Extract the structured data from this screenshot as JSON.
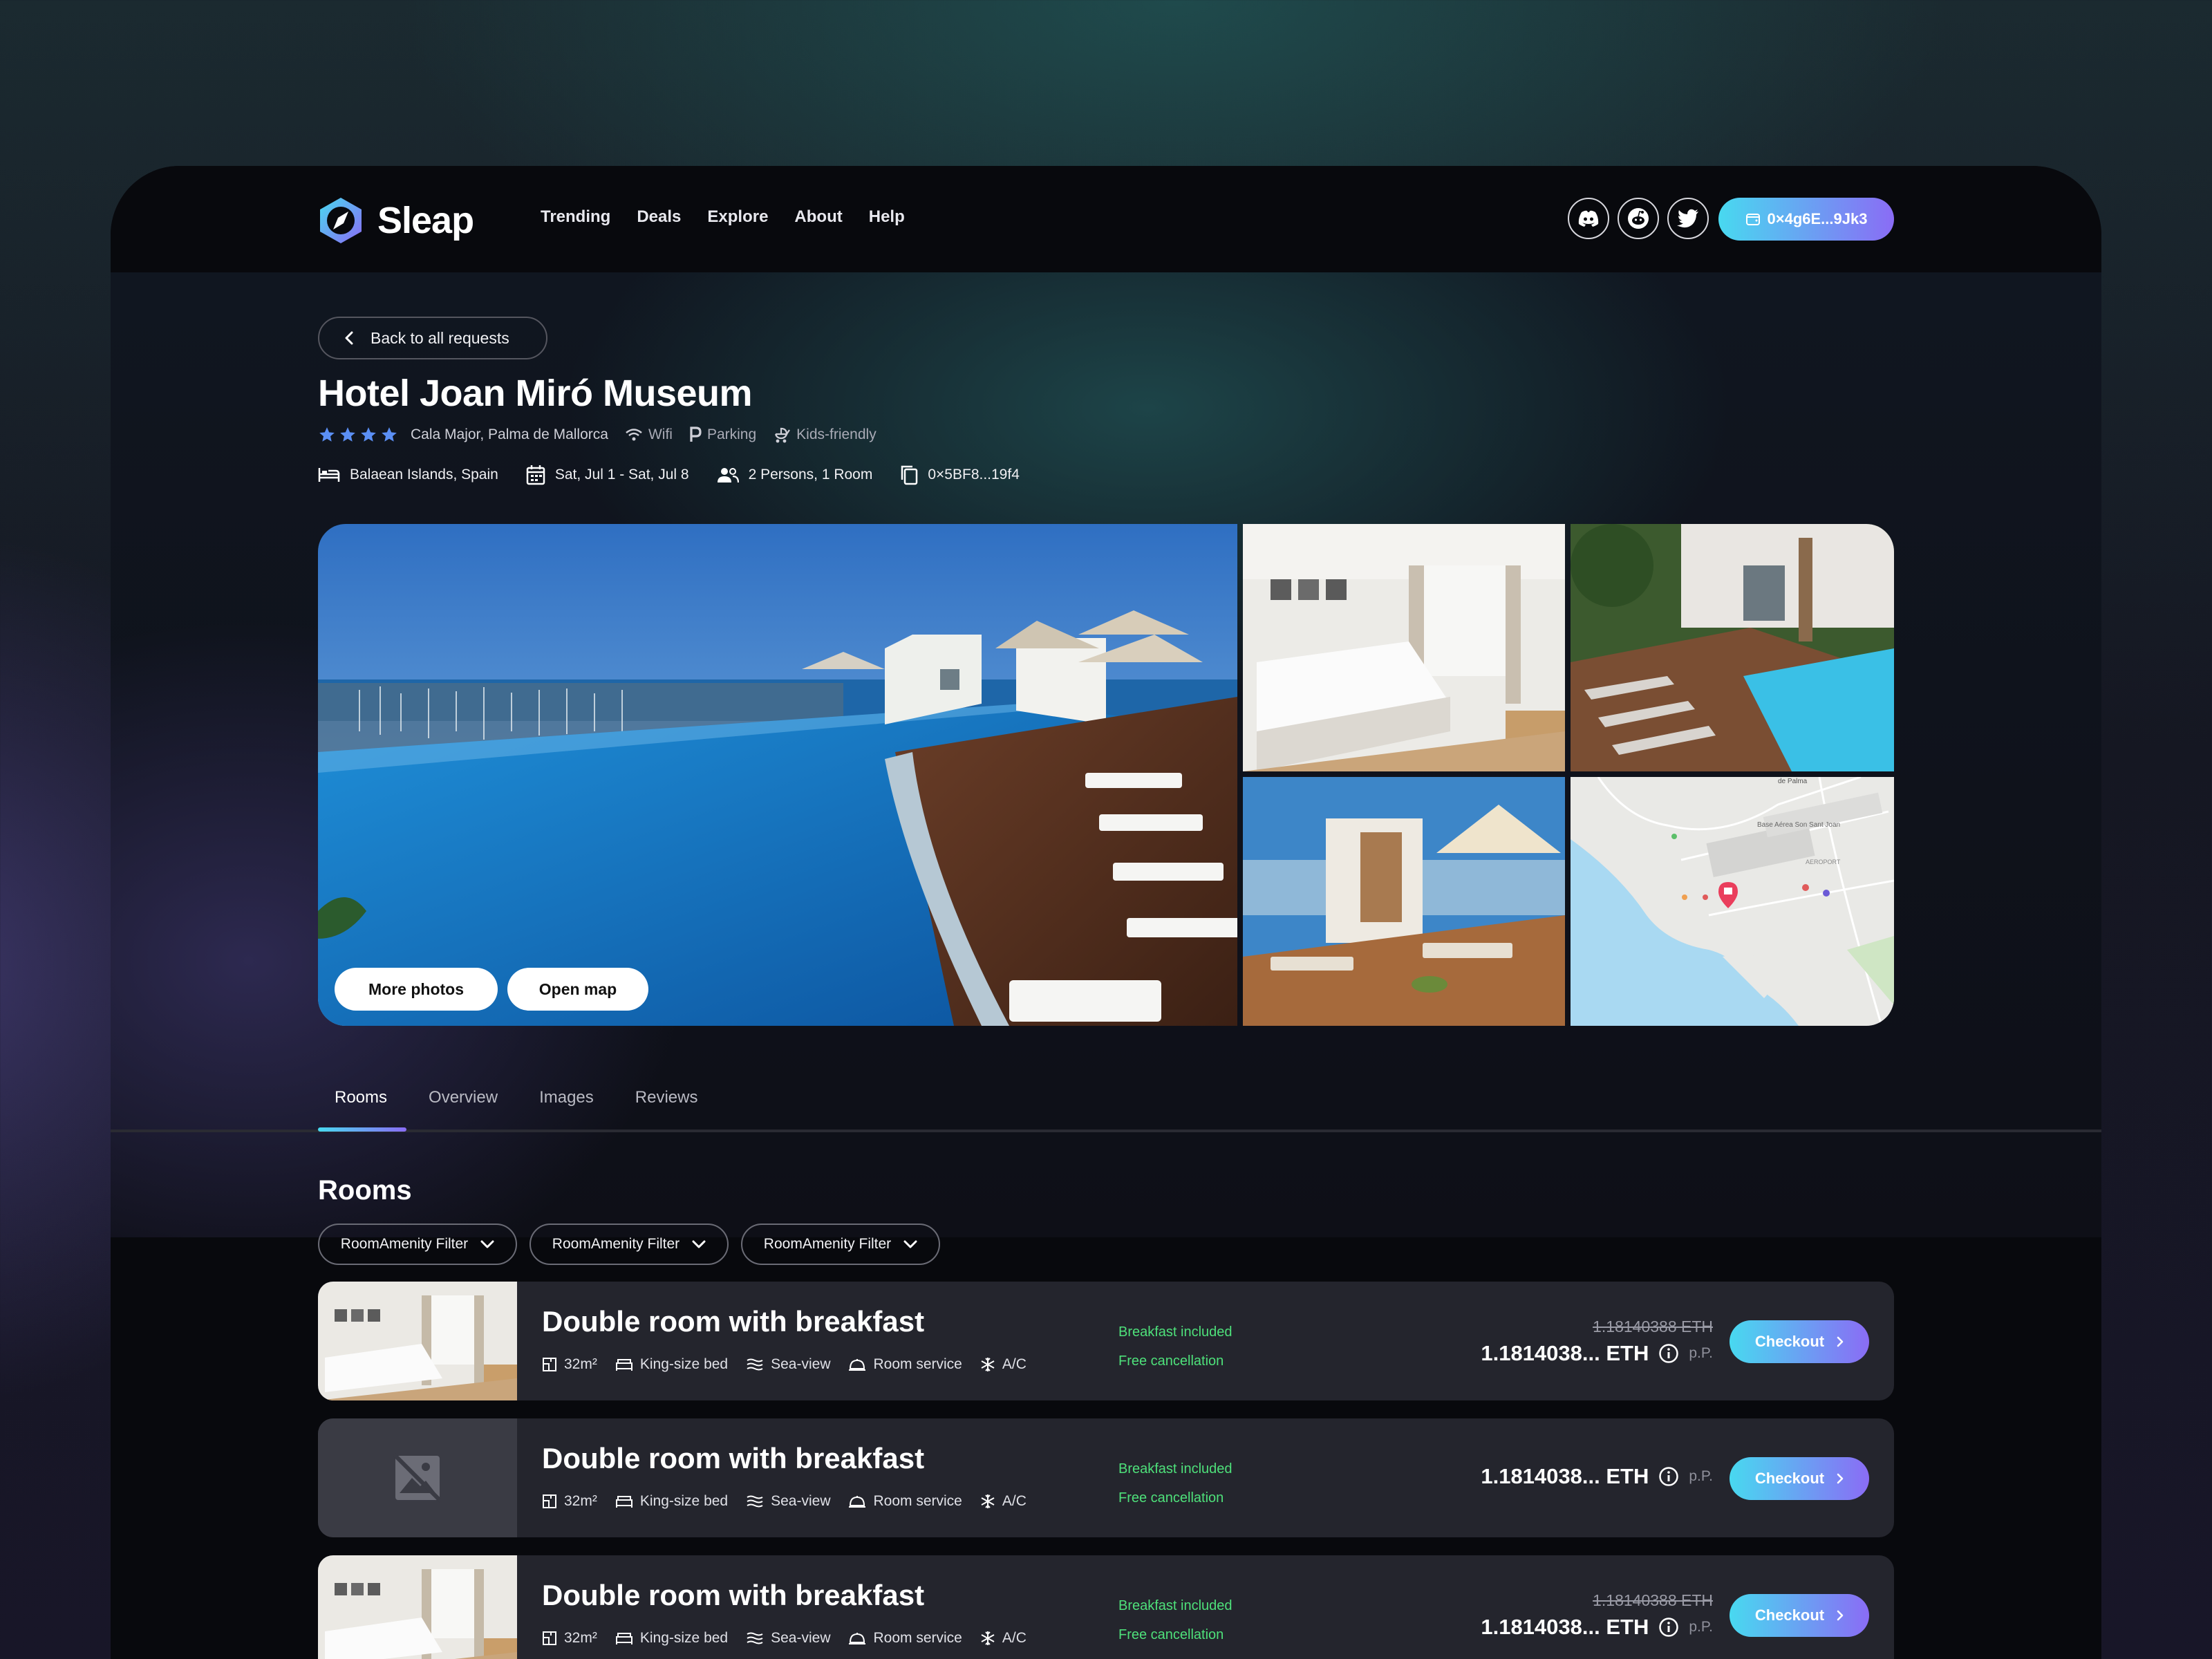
{
  "brand": {
    "name": "Sleap"
  },
  "nav": {
    "links": [
      "Trending",
      "Deals",
      "Explore",
      "About",
      "Help"
    ],
    "social": [
      "discord-icon",
      "reddit-icon",
      "twitter-icon"
    ],
    "wallet": "0×4g6E...9Jk3"
  },
  "header": {
    "back_label": "Back to all requests",
    "title": "Hotel Joan Miró Museum",
    "stars": 4,
    "location": "Cala Major, Palma de Mallorca",
    "amenities": [
      "Wifi",
      "Parking",
      "Kids-friendly"
    ],
    "region": "Balaean Islands, Spain",
    "dates": "Sat, Jul 1 - Sat, Jul 8",
    "guests": "2 Persons, 1 Room",
    "request_id": "0×5BF8...19f4"
  },
  "gallery": {
    "more_photos": "More photos",
    "open_map": "Open map",
    "map_labels": [
      "de Palma",
      "Base Aérea Son Sant Joan",
      "AEROPORT"
    ]
  },
  "tabs": [
    "Rooms",
    "Overview",
    "Images",
    "Reviews"
  ],
  "rooms_section": {
    "title": "Rooms",
    "filters": [
      "RoomAmenity Filter",
      "RoomAmenity Filter",
      "RoomAmenity Filter"
    ]
  },
  "rooms": [
    {
      "name": "Double room with breakfast",
      "features": [
        "32m²",
        "King-size bed",
        "Sea-view",
        "Room service",
        "A/C"
      ],
      "perks": [
        "Breakfast included",
        "Free cancellation"
      ],
      "old_price": "1.18140388 ETH",
      "price": "1.1814038... ETH",
      "per": "p.P.",
      "cta": "Checkout",
      "has_image": true
    },
    {
      "name": "Double room with breakfast",
      "features": [
        "32m²",
        "King-size bed",
        "Sea-view",
        "Room service",
        "A/C"
      ],
      "perks": [
        "Breakfast included",
        "Free cancellation"
      ],
      "old_price": "",
      "price": "1.1814038... ETH",
      "per": "p.P.",
      "cta": "Checkout",
      "has_image": false
    },
    {
      "name": "Double room with breakfast",
      "features": [
        "32m²",
        "King-size bed",
        "Sea-view",
        "Room service",
        "A/C"
      ],
      "perks": [
        "Breakfast included",
        "Free cancellation"
      ],
      "old_price": "1.18140388 ETH",
      "price": "1.1814038... ETH",
      "per": "p.P.",
      "cta": "Checkout",
      "has_image": true
    }
  ],
  "colors": {
    "accent_start": "#48d9f0",
    "accent_end": "#8a6cf5",
    "perk_green": "#4ee07a",
    "card_bg": "#24252d"
  }
}
